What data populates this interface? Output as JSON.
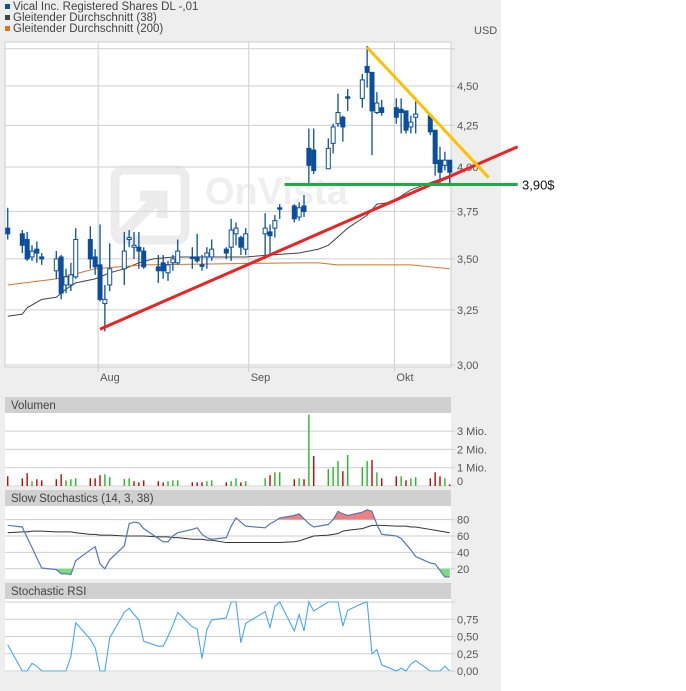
{
  "legend": [
    {
      "label": "Vical Inc. Registered Shares DL -,01",
      "color": "#0a4f9e"
    },
    {
      "label": "Gleitender Durchschnitt (38)",
      "color": "#444444"
    },
    {
      "label": "Gleitender Durchschnitt (200)",
      "color": "#e07020"
    }
  ],
  "currency": "USD",
  "watermark": "OnVista",
  "chart_data": [
    {
      "type": "candlestick",
      "yscale": "log",
      "ylim": [
        2.98,
        4.8
      ],
      "grid": true,
      "yticks": [
        {
          "v": 3.0,
          "label": "3,00"
        },
        {
          "v": 3.25,
          "label": "3,25"
        },
        {
          "v": 3.5,
          "label": "3,50"
        },
        {
          "v": 3.75,
          "label": "3,75"
        },
        {
          "v": 4.0,
          "label": "4,00"
        },
        {
          "v": 4.25,
          "label": "4,25"
        },
        {
          "v": 4.5,
          "label": "4,50"
        },
        {
          "v": 4.75,
          "label": ""
        }
      ],
      "xticks": [
        {
          "date": "08-01",
          "label": "Aug"
        },
        {
          "date": "09-01",
          "label": "Sep"
        },
        {
          "date": "10-01",
          "label": "Okt"
        }
      ],
      "candles_columns": [
        "date",
        "open",
        "high",
        "low",
        "close"
      ],
      "candles": [
        [
          "07-14",
          3.66,
          3.77,
          3.6,
          3.63
        ],
        [
          "07-17",
          3.63,
          3.65,
          3.53,
          3.57
        ],
        [
          "07-18",
          3.6,
          3.64,
          3.49,
          3.5
        ],
        [
          "07-19",
          3.51,
          3.57,
          3.49,
          3.54
        ],
        [
          "07-20",
          3.55,
          3.59,
          3.48,
          3.53
        ],
        [
          "07-21",
          3.51,
          3.53,
          3.47,
          3.5
        ],
        [
          "07-24",
          3.44,
          3.54,
          3.4,
          3.5
        ],
        [
          "07-25",
          3.51,
          3.52,
          3.3,
          3.33
        ],
        [
          "07-26",
          3.37,
          3.45,
          3.33,
          3.41
        ],
        [
          "07-27",
          3.37,
          3.48,
          3.34,
          3.42
        ],
        [
          "07-28",
          3.41,
          3.66,
          3.4,
          3.6
        ],
        [
          "07-31",
          3.6,
          3.67,
          3.45,
          3.5
        ],
        [
          "08-01",
          3.51,
          3.55,
          3.42,
          3.46
        ],
        [
          "08-02",
          3.47,
          3.68,
          3.29,
          3.3
        ],
        [
          "08-03",
          3.28,
          3.37,
          3.15,
          3.3
        ],
        [
          "08-04",
          3.37,
          3.58,
          3.34,
          3.45
        ],
        [
          "08-07",
          3.45,
          3.64,
          3.37,
          3.54
        ],
        [
          "08-08",
          3.6,
          3.65,
          3.56,
          3.61
        ],
        [
          "08-09",
          3.56,
          3.64,
          3.5,
          3.57
        ],
        [
          "08-10",
          3.56,
          3.64,
          3.45,
          3.54
        ],
        [
          "08-11",
          3.54,
          3.56,
          3.45,
          3.46
        ],
        [
          "08-14",
          3.46,
          3.52,
          3.38,
          3.44
        ],
        [
          "08-15",
          3.48,
          3.52,
          3.4,
          3.44
        ],
        [
          "08-16",
          3.43,
          3.49,
          3.39,
          3.47
        ],
        [
          "08-17",
          3.48,
          3.52,
          3.44,
          3.5
        ],
        [
          "08-18",
          3.48,
          3.6,
          3.47,
          3.54
        ],
        [
          "08-21",
          3.51,
          3.56,
          3.45,
          3.51
        ],
        [
          "08-22",
          3.51,
          3.63,
          3.48,
          3.49
        ],
        [
          "08-23",
          3.47,
          3.52,
          3.44,
          3.47
        ],
        [
          "08-24",
          3.51,
          3.56,
          3.45,
          3.53
        ],
        [
          "08-25",
          3.51,
          3.6,
          3.49,
          3.55
        ],
        [
          "08-28",
          3.55,
          3.56,
          3.5,
          3.53
        ],
        [
          "08-29",
          3.56,
          3.71,
          3.49,
          3.65
        ],
        [
          "08-30",
          3.63,
          3.69,
          3.57,
          3.66
        ],
        [
          "08-31",
          3.61,
          3.62,
          3.52,
          3.56
        ],
        [
          "09-01",
          3.55,
          3.66,
          3.52,
          3.63
        ],
        [
          "09-05",
          3.63,
          3.74,
          3.5,
          3.66
        ],
        [
          "09-06",
          3.64,
          3.68,
          3.52,
          3.62
        ],
        [
          "09-07",
          3.66,
          3.73,
          3.61,
          3.7
        ],
        [
          "09-08",
          3.77,
          3.79,
          3.71,
          3.77
        ],
        [
          "09-11",
          3.78,
          3.79,
          3.69,
          3.71
        ],
        [
          "09-12",
          3.72,
          3.8,
          3.7,
          3.77
        ],
        [
          "09-13",
          3.78,
          3.84,
          3.72,
          3.75
        ],
        [
          "09-14",
          4.11,
          4.23,
          3.9,
          4.01
        ],
        [
          "09-15",
          4.1,
          4.23,
          3.96,
          3.98
        ],
        [
          "09-18",
          3.99,
          4.17,
          3.99,
          4.11
        ],
        [
          "09-19",
          4.14,
          4.26,
          4.08,
          4.24
        ],
        [
          "09-20",
          4.26,
          4.45,
          4.24,
          4.33
        ],
        [
          "09-21",
          4.3,
          4.31,
          4.15,
          4.24
        ],
        [
          "09-22",
          4.43,
          4.48,
          4.34,
          4.43
        ],
        [
          "09-25",
          4.42,
          4.58,
          4.36,
          4.54
        ],
        [
          "09-26",
          4.63,
          4.77,
          4.49,
          4.59
        ],
        [
          "09-27",
          4.59,
          4.59,
          4.07,
          4.34
        ],
        [
          "09-28",
          4.33,
          4.46,
          4.32,
          4.39
        ],
        [
          "09-29",
          4.36,
          4.41,
          4.31,
          4.33
        ],
        [
          "10-02",
          4.36,
          4.42,
          4.26,
          4.3
        ],
        [
          "10-03",
          4.35,
          4.42,
          4.2,
          4.33
        ],
        [
          "10-04",
          4.34,
          4.34,
          4.2,
          4.22
        ],
        [
          "10-05",
          4.24,
          4.31,
          4.2,
          4.27
        ],
        [
          "10-06",
          4.3,
          4.4,
          4.2,
          4.32
        ],
        [
          "10-09",
          4.31,
          4.31,
          4.19,
          4.21
        ],
        [
          "10-10",
          4.22,
          4.22,
          3.95,
          4.02
        ],
        [
          "10-11",
          4.04,
          4.12,
          3.9,
          3.97
        ],
        [
          "10-12",
          4.01,
          4.09,
          3.98,
          4.04
        ],
        [
          "10-13",
          4.04,
          4.04,
          3.89,
          3.97
        ]
      ],
      "series": [
        {
          "name": "Gleitender Durchschnitt (38)",
          "color": "#444444",
          "points": [
            [
              "07-14",
              3.22
            ],
            [
              "07-17",
              3.23
            ],
            [
              "07-18",
              3.26
            ],
            [
              "07-21",
              3.3
            ],
            [
              "07-24",
              3.31
            ],
            [
              "07-26",
              3.35
            ],
            [
              "07-28",
              3.38
            ],
            [
              "08-01",
              3.4
            ],
            [
              "08-04",
              3.43
            ],
            [
              "08-07",
              3.45
            ],
            [
              "08-10",
              3.48
            ],
            [
              "08-13",
              3.5
            ],
            [
              "08-17",
              3.51
            ],
            [
              "09-01",
              3.51
            ],
            [
              "09-06",
              3.52
            ],
            [
              "09-12",
              3.53
            ],
            [
              "09-16",
              3.55
            ],
            [
              "09-18",
              3.57
            ],
            [
              "09-22",
              3.66
            ],
            [
              "09-26",
              3.73
            ],
            [
              "09-28",
              3.79
            ],
            [
              "10-01",
              3.8
            ],
            [
              "10-05",
              3.87
            ],
            [
              "10-09",
              3.91
            ],
            [
              "10-12",
              3.94
            ],
            [
              "10-13",
              3.95
            ]
          ]
        },
        {
          "name": "Gleitender Durchschnitt (200)",
          "color": "#e07020",
          "points": [
            [
              "07-14",
              3.37
            ],
            [
              "07-24",
              3.4
            ],
            [
              "08-01",
              3.45
            ],
            [
              "08-11",
              3.47
            ],
            [
              "09-12",
              3.48
            ],
            [
              "09-16",
              3.48
            ],
            [
              "09-20",
              3.47
            ],
            [
              "10-05",
              3.47
            ],
            [
              "10-09",
              3.46
            ],
            [
              "10-13",
              3.45
            ]
          ]
        }
      ],
      "annotations": [
        {
          "kind": "trendline",
          "color": "#ee2222",
          "from": [
            "08-02",
            3.16
          ],
          "to": [
            "10-27",
            4.12
          ]
        },
        {
          "kind": "trendline",
          "color": "#ffc000",
          "from": [
            "09-26",
            4.76
          ],
          "to": [
            "10-21",
            3.94
          ]
        },
        {
          "kind": "hline",
          "color": "#22aa44",
          "value": 3.9,
          "from": "09-09",
          "to": "10-27",
          "label": "3,90$"
        }
      ]
    },
    {
      "type": "bar",
      "title": "Volumen",
      "yticks": [
        {
          "v": 0,
          "label": "0"
        },
        {
          "v": 1,
          "label": "1 Mio."
        },
        {
          "v": 2,
          "label": "2 Mio."
        },
        {
          "v": 3,
          "label": "3 Mio."
        }
      ],
      "unit": "Mio.",
      "values": [
        0.53,
        0.42,
        0.7,
        0.26,
        0.37,
        0.31,
        0.37,
        0.64,
        0.31,
        0.37,
        0.42,
        0.42,
        0.42,
        0.59,
        0.64,
        0.48,
        0.39,
        0.42,
        0.26,
        0.2,
        0.31,
        0.26,
        0.2,
        0.26,
        0.31,
        0.31,
        0.2,
        0.2,
        0.2,
        0.26,
        0.31,
        0.2,
        0.26,
        0.42,
        0.2,
        0.26,
        0.42,
        0.59,
        0.75,
        0.75,
        0.37,
        0.42,
        0.37,
        3.9,
        1.64,
        0.92,
        1.03,
        1.36,
        0.81,
        1.69,
        1.03,
        1.36,
        1.42,
        0.75,
        0.42,
        0.53,
        0.53,
        0.31,
        0.42,
        0.48,
        0.42,
        0.75,
        0.53,
        0.42,
        0.09
      ],
      "direction": [
        "down",
        "down",
        "down",
        "up",
        "down",
        "down",
        "down",
        "down",
        "up",
        "up",
        "up",
        "down",
        "down",
        "down",
        "up",
        "up",
        "up",
        "up",
        "down",
        "down",
        "down",
        "down",
        "down",
        "up",
        "up",
        "up",
        "down",
        "down",
        "down",
        "up",
        "up",
        "down",
        "up",
        "up",
        "down",
        "up",
        "up",
        "down",
        "up",
        "up",
        "down",
        "up",
        "down",
        "up",
        "down",
        "up",
        "up",
        "up",
        "down",
        "up",
        "up",
        "up",
        "down",
        "up",
        "down",
        "down",
        "up",
        "down",
        "up",
        "up",
        "down",
        "down",
        "down",
        "up",
        "down"
      ],
      "colors": {
        "up": "#22bb22",
        "down": "#cc0000"
      }
    },
    {
      "type": "line",
      "title": "Slow Stochastics (14, 3, 38)",
      "ylim": [
        0,
        100
      ],
      "yticks": [
        {
          "v": 20,
          "label": "20"
        },
        {
          "v": 40,
          "label": "40"
        },
        {
          "v": 60,
          "label": "60"
        },
        {
          "v": 80,
          "label": "80"
        }
      ],
      "k": [
        73,
        71,
        58,
        46,
        33,
        21,
        19,
        14,
        14,
        13,
        30,
        43,
        47,
        26,
        20,
        31,
        48,
        75,
        77,
        76,
        69,
        57,
        53,
        53,
        60,
        64,
        68,
        70,
        62,
        58,
        56,
        58,
        72,
        82,
        77,
        72,
        70,
        75,
        78,
        82,
        85,
        87,
        81,
        75,
        71,
        74,
        80,
        90,
        87,
        85,
        89,
        92,
        90,
        74,
        62,
        60,
        57,
        50,
        43,
        35,
        27,
        26,
        18,
        10,
        10
      ],
      "d": [
        64,
        65,
        65,
        66,
        66,
        66,
        65,
        65,
        65,
        65,
        64,
        62,
        62,
        61,
        61,
        61,
        60,
        60,
        60,
        60,
        60,
        59,
        59,
        59,
        58,
        58,
        56,
        56,
        56,
        55,
        55,
        52,
        52,
        52,
        52,
        52,
        52,
        52,
        52,
        52,
        53,
        54,
        56,
        58,
        60,
        61,
        62,
        63,
        66,
        67,
        69,
        71,
        73,
        73,
        73,
        72,
        72,
        72,
        71,
        71,
        68,
        67,
        66,
        65,
        64
      ],
      "colors": {
        "k": "#5577bb",
        "d": "#333333",
        "overbought": "#f08080",
        "oversold": "#77dd77"
      },
      "levels": [
        20,
        80
      ]
    },
    {
      "type": "line",
      "title": "Stochastic RSI",
      "ylim": [
        0,
        1
      ],
      "yticks": [
        {
          "v": 0,
          "label": "0,00"
        },
        {
          "v": 0.25,
          "label": "0,25"
        },
        {
          "v": 0.5,
          "label": "0,50"
        },
        {
          "v": 0.75,
          "label": "0,75"
        }
      ],
      "values": [
        0.38,
        0,
        0,
        0.11,
        0.07,
        0,
        0,
        0,
        0,
        0.21,
        0.7,
        0.46,
        0.34,
        0,
        0,
        0.48,
        0.85,
        0.91,
        0.82,
        0.74,
        0.43,
        0.36,
        0.36,
        0.5,
        0.66,
        0.85,
        0.64,
        0.61,
        0.18,
        0.6,
        0.74,
        0.77,
        1,
        1,
        0.41,
        0.69,
        0.86,
        0.63,
        0.94,
        1,
        0.58,
        0.82,
        0.58,
        1,
        0.87,
        1,
        1,
        1,
        0.65,
        0.88,
        0.98,
        1,
        0.25,
        0.31,
        0.09,
        0,
        0.04,
        0,
        0.1,
        0.15,
        0,
        0,
        0,
        0.07,
        0
      ],
      "color": "#44aaee"
    }
  ]
}
